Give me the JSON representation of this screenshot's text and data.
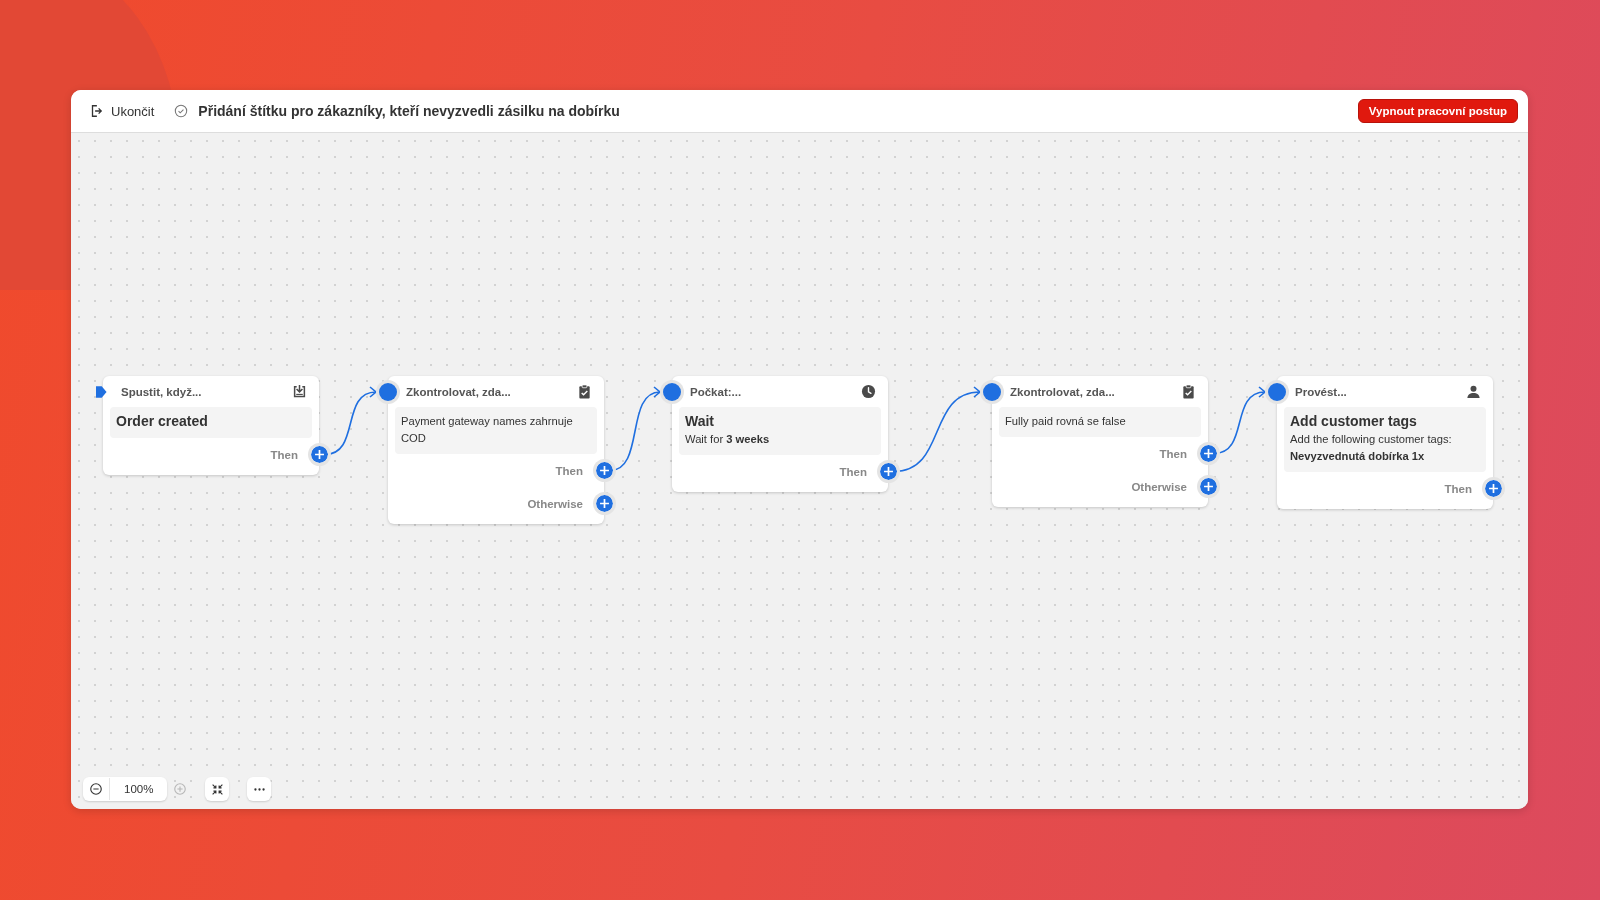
{
  "header": {
    "exit_label": "Ukončit",
    "title": "Přidání štítku pro zákazníky, kteří nevyzvedli zásilku na dobírku",
    "turn_off_button": "Vypnout pracovní postup"
  },
  "nodes": [
    {
      "kind": "trigger",
      "heading": "Spustit, když...",
      "title": "Order created",
      "outputs": [
        {
          "label": "Then"
        }
      ]
    },
    {
      "kind": "condition",
      "heading": "Zkontrolovat, zda...",
      "lines": [
        "Payment gateway names zahrnuje COD"
      ],
      "outputs": [
        {
          "label": "Then"
        },
        {
          "label": "Otherwise"
        }
      ]
    },
    {
      "kind": "wait",
      "heading": "Počkat:...",
      "title": "Wait",
      "lines": [
        "Wait for **3 weeks**"
      ],
      "outputs": [
        {
          "label": "Then"
        }
      ]
    },
    {
      "kind": "condition",
      "heading": "Zkontrolovat, zda...",
      "lines": [
        "Fully paid rovná se false"
      ],
      "outputs": [
        {
          "label": "Then"
        },
        {
          "label": "Otherwise"
        }
      ]
    },
    {
      "kind": "action",
      "heading": "Provést...",
      "title": "Add customer tags",
      "lines": [
        "Add the following customer tags:",
        "**Nevyzvednutá dobírka 1x**"
      ],
      "outputs": [
        {
          "label": "Then"
        }
      ]
    }
  ],
  "zoom_controls": {
    "level": "100%",
    "zoom_out_disabled": false,
    "zoom_in_disabled": true
  }
}
